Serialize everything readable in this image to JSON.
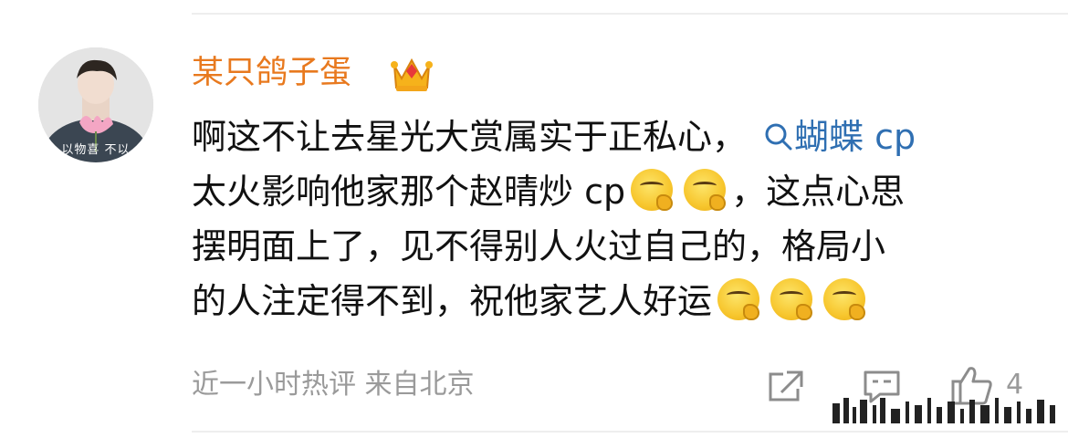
{
  "user": {
    "name": "某只鸽子蛋",
    "avatar_caption": "以物喜 不以"
  },
  "comment": {
    "line1_text": "啊这不让去星光大赏属实于正私心，",
    "topic_link": "蝴蝶 cp",
    "line2_text": "太火影响他家那个赵晴炒 cp",
    "line2_tail": "，这点心思",
    "line3_text": "摆明面上了，见不得别人火过自己的，格局小",
    "line4_text": "的人注定得不到，祝他家艺人好运"
  },
  "meta": {
    "hot_label": "近一小时热评",
    "location": "来自北京"
  },
  "actions": {
    "like_count": "4"
  },
  "colors": {
    "username": "#e8791e",
    "topic": "#2f6fb2",
    "meta": "#9a9a9a"
  },
  "icons": [
    "crown-icon",
    "search-icon",
    "thinking-emoji",
    "share-icon",
    "comment-icon",
    "like-icon"
  ]
}
